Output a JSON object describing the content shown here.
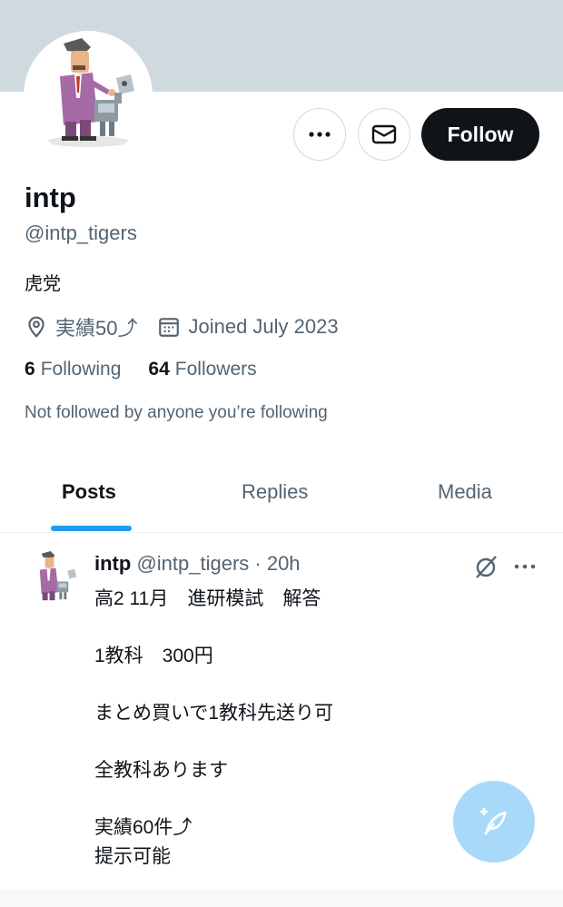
{
  "profile": {
    "name": "intp",
    "handle": "@intp_tigers",
    "bio": "虎党",
    "location": "実績50⤴",
    "joined": "Joined July 2023",
    "following_count": "6",
    "following_label": "Following",
    "followers_count": "64",
    "followers_label": "Followers",
    "not_followed_note": "Not followed by anyone you’re following"
  },
  "actions": {
    "more_icon": "more-icon",
    "message_icon": "envelope-icon",
    "follow_label": "Follow"
  },
  "tabs": [
    {
      "label": "Posts",
      "active": true
    },
    {
      "label": "Replies",
      "active": false
    },
    {
      "label": "Media",
      "active": false
    }
  ],
  "post": {
    "author_name": "intp",
    "author_handle": "@intp_tigers · 20h",
    "body": "高2 11月　進研模試　解答\n\n1教科　300円\n\nまとめ買いで1教科先送り可\n\n全教科あります\n\n実績60件⤴\n提示可能"
  },
  "fab": {
    "icon": "compose-feather-icon"
  },
  "colors": {
    "banner": "#cfd9de",
    "accent": "#1d9bf0",
    "text_primary": "#0f1419",
    "text_secondary": "#536471",
    "follow_button": "#0f1419"
  }
}
